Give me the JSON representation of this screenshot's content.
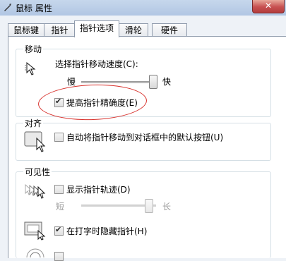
{
  "window": {
    "title": "鼠标 属性",
    "close_glyph": "✕"
  },
  "tabs": [
    {
      "label": "鼠标键",
      "active": false
    },
    {
      "label": "指针",
      "active": false
    },
    {
      "label": "指针选项",
      "active": true
    },
    {
      "label": "滑轮",
      "active": false
    },
    {
      "label": "硬件",
      "active": false
    }
  ],
  "motion": {
    "group_label": "移动",
    "speed_label": "选择指针移动速度(C):",
    "slow_label": "慢",
    "fast_label": "快",
    "speed_level": 0.95,
    "precision_label": "提高指针精确度(E)",
    "precision_checked": true
  },
  "snap": {
    "group_label": "对齐",
    "snap_label": "自动将指针移动到对话框中的默认按钮(U)",
    "snap_checked": false
  },
  "visibility": {
    "group_label": "可见性",
    "trails_label": "显示指针轨迹(D)",
    "trails_checked": false,
    "short_label": "短",
    "long_label": "长",
    "trail_level": 0.9,
    "hide_label": "在打字时隐藏指针(H)",
    "hide_checked": true
  },
  "colors": {
    "annotation_ellipse": "#d7302b"
  }
}
